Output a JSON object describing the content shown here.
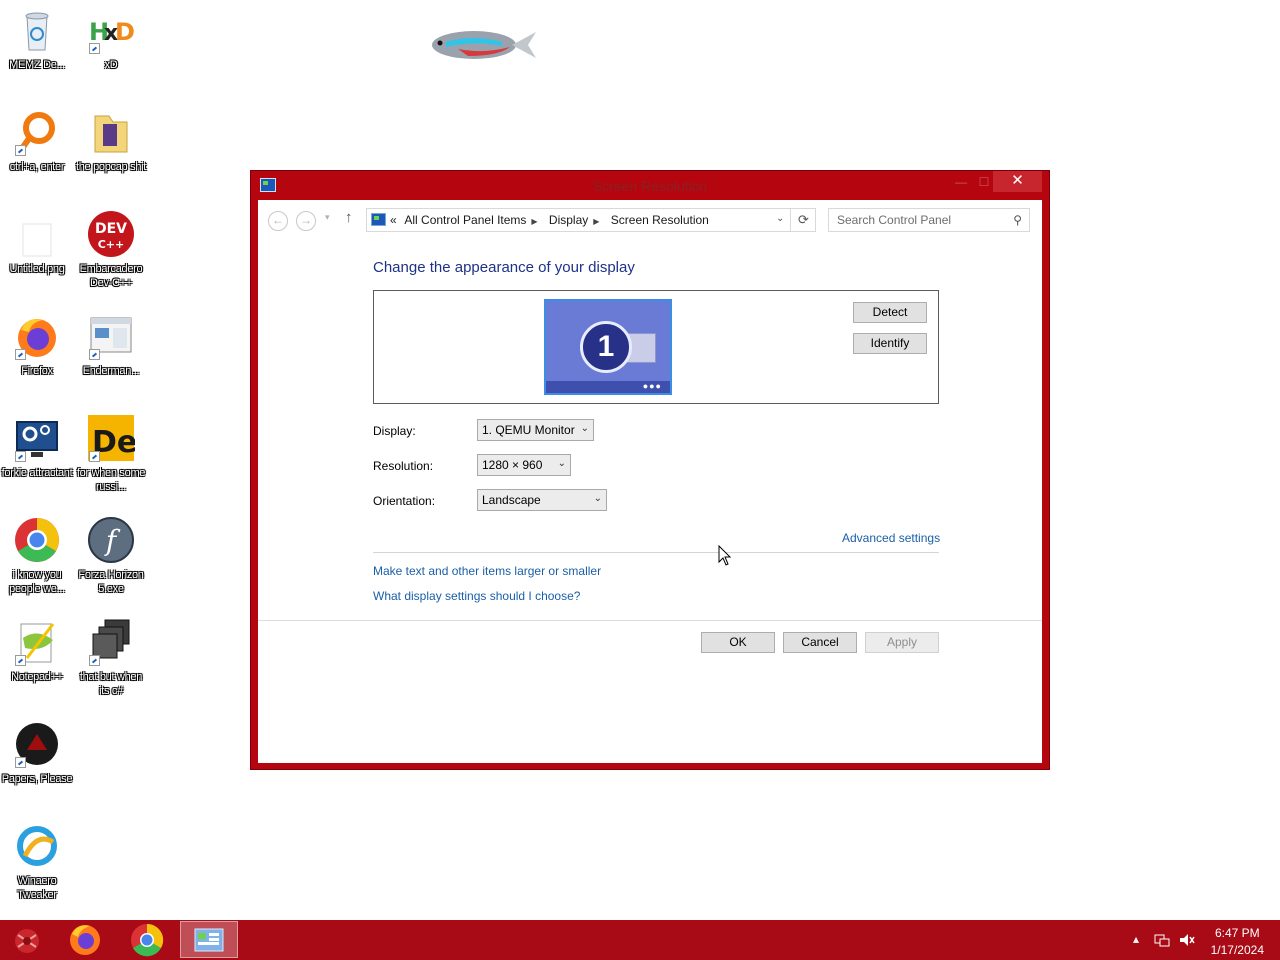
{
  "desktop": {
    "icons": [
      {
        "label": "MEMZ De...",
        "icon": "recycle-bin-icon"
      },
      {
        "label": "xD",
        "icon": "hxd-icon"
      },
      {
        "label": "ctrl+a, enter",
        "icon": "search-app-icon"
      },
      {
        "label": "the popcap shit",
        "icon": "folder-icon"
      },
      {
        "label": "Untitled.png",
        "icon": "image-file-icon"
      },
      {
        "label": "Embarcadero Dev-C++",
        "icon": "devcpp-icon"
      },
      {
        "label": "Firefox",
        "icon": "firefox-icon"
      },
      {
        "label": "Enderman...",
        "icon": "app-window-icon"
      },
      {
        "label": "forkie attractant",
        "icon": "monitor-gear-icon"
      },
      {
        "label": "for when some russi...",
        "icon": "de-icon"
      },
      {
        "label": "i know you people we...",
        "icon": "chrome-icon"
      },
      {
        "label": "Forza Horizon 5.exe",
        "icon": "flash-icon"
      },
      {
        "label": "Notepad++",
        "icon": "notepadpp-icon"
      },
      {
        "label": "that but when its c#",
        "icon": "stacked-windows-icon"
      },
      {
        "label": "Papers, Please",
        "icon": "papers-please-icon"
      },
      {
        "label": "Winaero Tweaker",
        "icon": "winaero-icon"
      }
    ]
  },
  "window": {
    "title": "Screen Resolution",
    "title_buttons": {
      "minimize": "—",
      "maximize": "☐",
      "close": "✕"
    },
    "address": {
      "overflow": "«",
      "crumbs": [
        "All Control Panel Items",
        "Display",
        "Screen Resolution"
      ]
    },
    "search": {
      "placeholder": "Search Control Panel"
    },
    "heading": "Change the appearance of your display",
    "monitor_number": "1",
    "buttons": {
      "detect": "Detect",
      "identify": "Identify",
      "ok": "OK",
      "cancel": "Cancel",
      "apply": "Apply"
    },
    "fields": {
      "display": {
        "label": "Display:",
        "value": "1. QEMU Monitor"
      },
      "resolution": {
        "label": "Resolution:",
        "value": "1280 × 960"
      },
      "orientation": {
        "label": "Orientation:",
        "value": "Landscape"
      }
    },
    "links": {
      "advanced": "Advanced settings",
      "text_size": "Make text and other items larger or smaller",
      "which_settings": "What display settings should I choose?"
    }
  },
  "taskbar": {
    "items": [
      "start-orb",
      "firefox",
      "chrome",
      "control-panel"
    ],
    "clock": {
      "time": "6:47 PM",
      "date": "1/17/2024"
    }
  },
  "colors": {
    "accent": "#b5060f",
    "taskbar": "#a80b16",
    "link": "#1a5fa8",
    "heading": "#1e3287"
  }
}
